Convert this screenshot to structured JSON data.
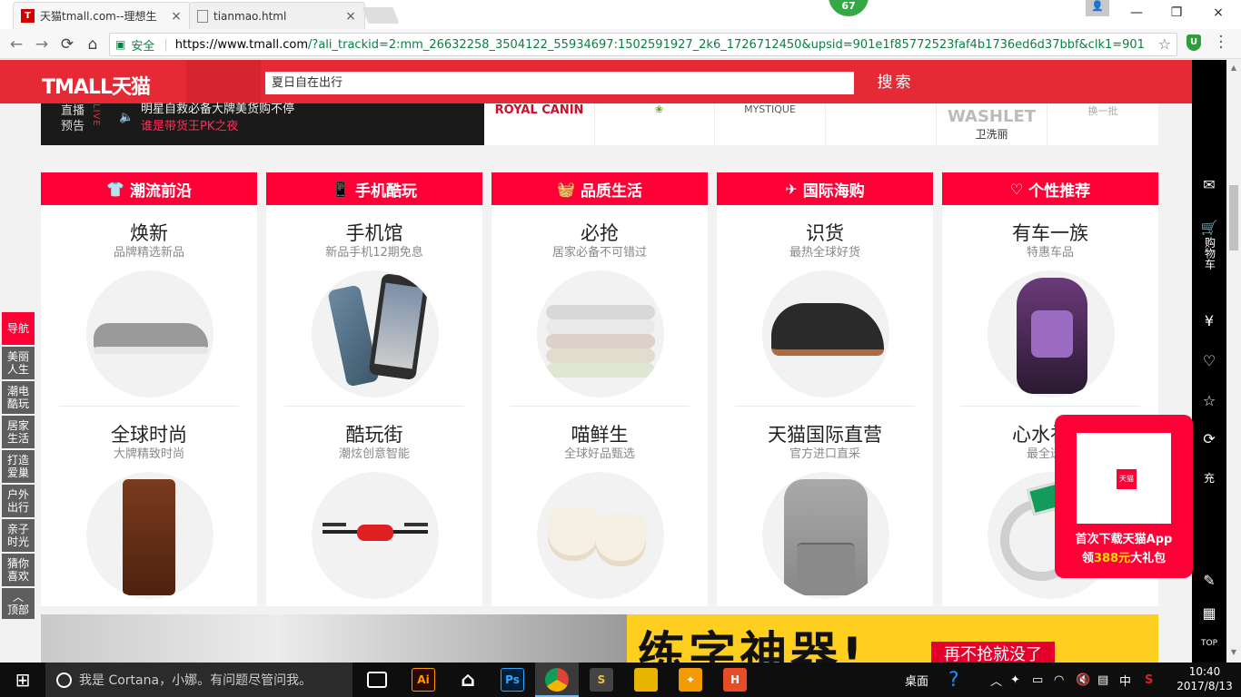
{
  "browser": {
    "tabs": [
      {
        "title": "天猫tmall.com--理想生",
        "favicon": "T"
      },
      {
        "title": "tianmao.html",
        "favicon": ""
      }
    ],
    "extension_badge": "67",
    "secure_label": "安全",
    "url_host": "https://www.tmall.com",
    "url_rest": "/?ali_trackid=2:mm_26632258_3504122_55934697:1502591927_2k6_1726712450&upsid=901e1f85772523faf4b1736ed6d37bbf&clk1=901",
    "icons": {
      "back": "←",
      "forward": "→",
      "reload": "⟳",
      "home": "⌂",
      "lock": "🔒",
      "star": "☆",
      "close": "×",
      "minimize": "—",
      "maximize": "❐"
    }
  },
  "header": {
    "logo": "TMALL天猫",
    "search_value": "夏日自在出行",
    "search_button": "搜索"
  },
  "live": {
    "label_top": "直播",
    "label_bottom": "预告",
    "live_tag": "LIVE",
    "line1": "明星自救必备大牌美货购不停",
    "line2": "谁是带货王PK之夜"
  },
  "brands": [
    "ROYAL CANIN",
    "",
    "MYSTIQUE",
    "",
    "WASHLET",
    "换一批"
  ],
  "brand_sub": {
    "mystique_top": "",
    "washlet_sub": "卫洗丽",
    "swap": "换一批"
  },
  "columns": [
    {
      "header": "潮流前沿",
      "icon": "👕",
      "cells": [
        {
          "title": "焕新",
          "subtitle": "品牌精选新品"
        },
        {
          "title": "全球时尚",
          "subtitle": "大牌精致时尚"
        }
      ]
    },
    {
      "header": "手机酷玩",
      "icon": "📱",
      "cells": [
        {
          "title": "手机馆",
          "subtitle": "新品手机12期免息"
        },
        {
          "title": "酷玩街",
          "subtitle": "潮炫创意智能"
        }
      ]
    },
    {
      "header": "品质生活",
      "icon": "🧺",
      "cells": [
        {
          "title": "必抢",
          "subtitle": "居家必备不可错过"
        },
        {
          "title": "喵鲜生",
          "subtitle": "全球好品甄选"
        }
      ]
    },
    {
      "header": "国际海购",
      "icon": "✈",
      "cells": [
        {
          "title": "识货",
          "subtitle": "最热全球好货"
        },
        {
          "title": "天猫国际直营",
          "subtitle": "官方进口直采"
        }
      ]
    },
    {
      "header": "个性推荐",
      "icon": "♡",
      "cells": [
        {
          "title": "有车一族",
          "subtitle": "特惠车品"
        },
        {
          "title": "心水礼物",
          "subtitle": "最全送礼"
        }
      ]
    }
  ],
  "left_nav": [
    "导航",
    "美丽人生",
    "潮电酷玩",
    "居家生活",
    "打造爱巢",
    "户外出行",
    "亲子时光",
    "猜你喜欢",
    "顶部"
  ],
  "right_bar": {
    "cart": "购物车",
    "icons": [
      "✉",
      "¥",
      "♡",
      "☆",
      "⟳",
      "充",
      "✎",
      "▦",
      "TOP"
    ]
  },
  "qr_popup": {
    "line1": "首次下载天猫App",
    "line2_prefix": "领",
    "line2_amount": "388元",
    "line2_suffix": "大礼包",
    "center_label": "天猫"
  },
  "banner": {
    "headline": "练字神器!",
    "pill": "再不抢就没了"
  },
  "taskbar": {
    "cortana": "我是 Cortana，小娜。有问题尽管问我。",
    "desktop": "桌面",
    "ime": "中",
    "time": "10:40",
    "date": "2017/8/13"
  }
}
